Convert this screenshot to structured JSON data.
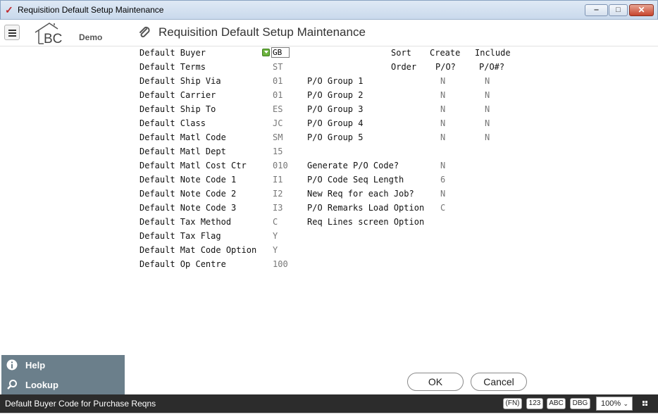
{
  "window": {
    "title": "Requisition Default Setup Maintenance"
  },
  "header": {
    "logo_text": "BC",
    "logo_sub": "Demo",
    "page_title": "Requisition Default Setup Maintenance"
  },
  "form": {
    "buyer_label": "Default Buyer",
    "buyer_value": "GB",
    "left_fields": [
      {
        "label": "Default Terms",
        "value": "ST"
      },
      {
        "label": "Default Ship Via",
        "value": "01"
      },
      {
        "label": "Default Carrier",
        "value": "01"
      },
      {
        "label": "Default Ship To",
        "value": "ES"
      },
      {
        "label": "Default Class",
        "value": "JC"
      },
      {
        "label": "Default Matl Code",
        "value": "SM"
      },
      {
        "label": "Default Matl Dept",
        "value": "15"
      },
      {
        "label": "Default Matl Cost Ctr",
        "value": "010"
      },
      {
        "label": "Default Note Code 1",
        "value": "I1"
      },
      {
        "label": "Default Note Code 2",
        "value": "I2"
      },
      {
        "label": "Default Note Code 3",
        "value": "I3"
      },
      {
        "label": "Default Tax Method",
        "value": "C"
      },
      {
        "label": "Default Tax Flag",
        "value": "Y"
      },
      {
        "label": "Default Mat Code Option",
        "value": "Y"
      },
      {
        "label": "Default Op Centre",
        "value": "100"
      }
    ],
    "headers": {
      "sort_1": "Sort",
      "sort_2": "Order",
      "create_1": "Create",
      "create_2": "P/O?",
      "include_1": "Include",
      "include_2": "P/O#?"
    },
    "groups": [
      {
        "label": "P/O Group 1",
        "create": "N",
        "include": "N"
      },
      {
        "label": "P/O Group 2",
        "create": "N",
        "include": "N"
      },
      {
        "label": "P/O Group 3",
        "create": "N",
        "include": "N"
      },
      {
        "label": "P/O Group 4",
        "create": "N",
        "include": "N"
      },
      {
        "label": "P/O Group 5",
        "create": "N",
        "include": "N"
      }
    ],
    "options": [
      {
        "label": "Generate P/O Code?",
        "value": "N"
      },
      {
        "label": "P/O Code Seq Length",
        "value": "6"
      },
      {
        "label": "New Req for each Job?",
        "value": "N"
      },
      {
        "label": "P/O Remarks Load Option",
        "value": "C"
      },
      {
        "label": "Req Lines screen Option",
        "value": ""
      }
    ]
  },
  "side_panel": {
    "help": "Help",
    "lookup": "Lookup"
  },
  "buttons": {
    "ok": "OK",
    "cancel": "Cancel"
  },
  "status": {
    "text": "Default Buyer Code for Purchase Reqns",
    "chips": [
      "(FN)",
      "123",
      "ABC",
      "DBG"
    ],
    "zoom": "100%"
  }
}
